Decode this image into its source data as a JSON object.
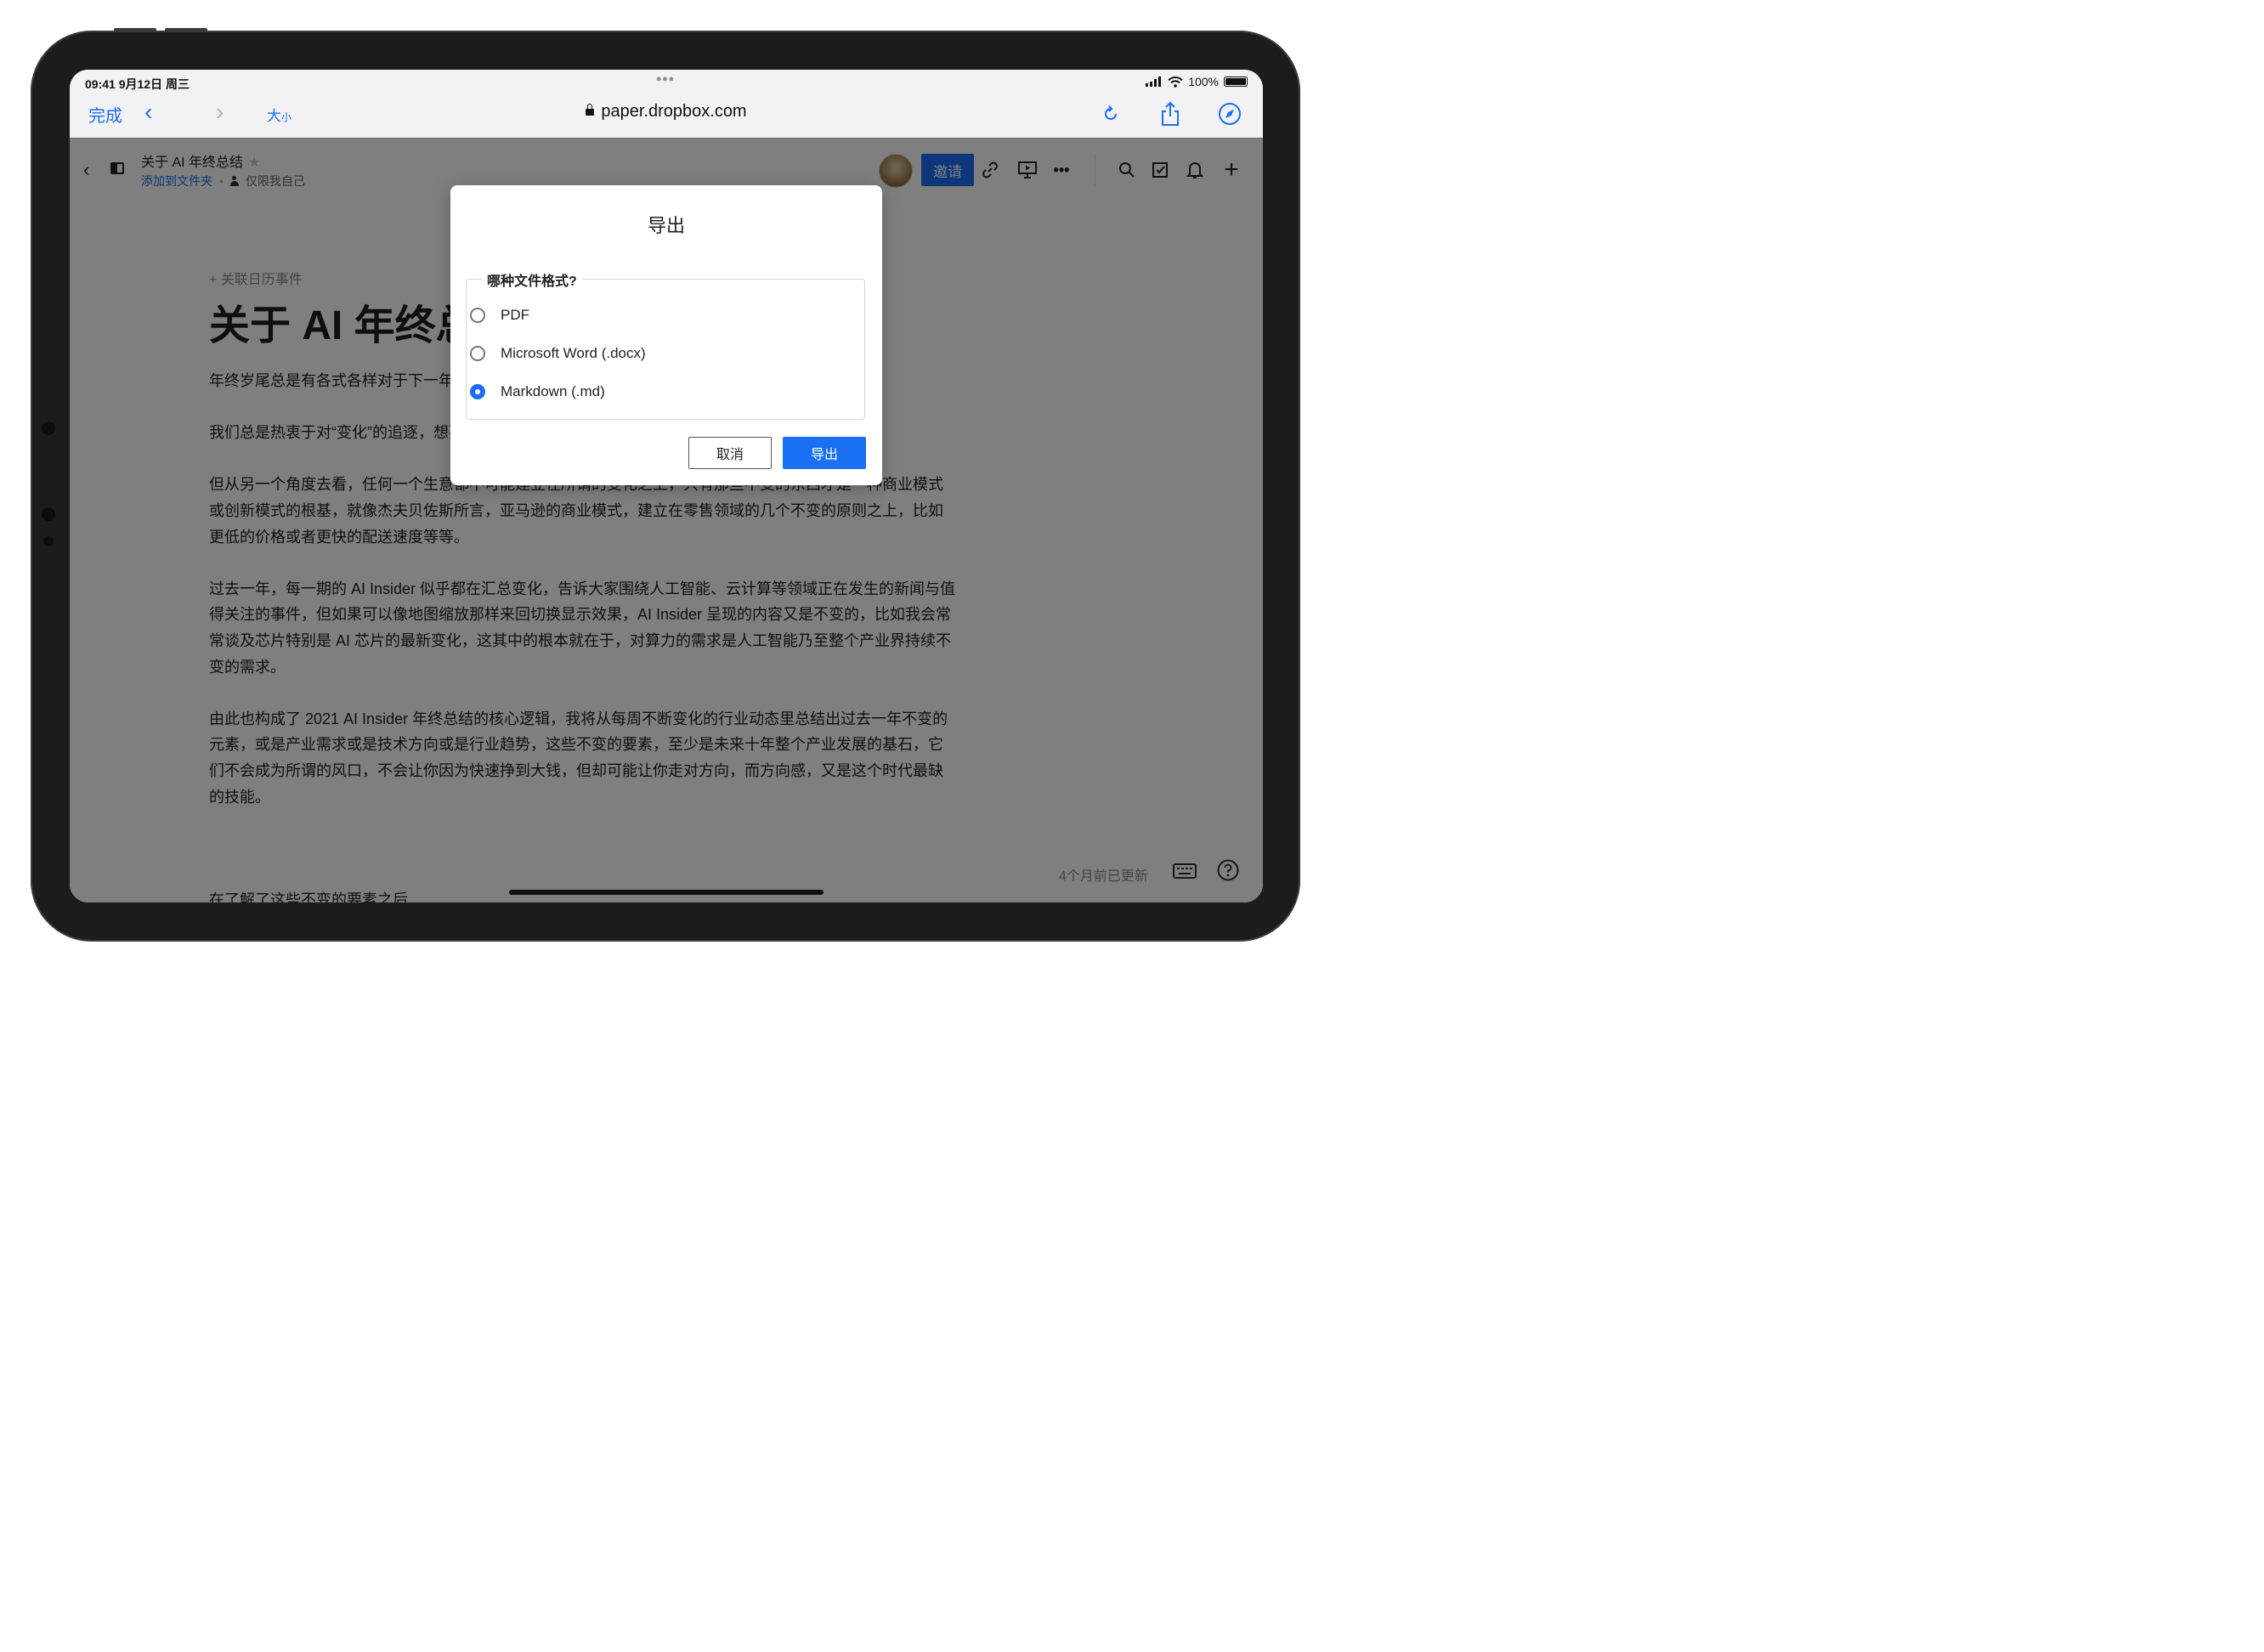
{
  "status_bar": {
    "time_date": "09:41   9月12日 周三",
    "dots": "•••",
    "battery": "100%"
  },
  "browser": {
    "done_label": "完成",
    "back_icon": "‹",
    "forward_icon": "›",
    "text_size_big": "大",
    "text_size_small": "小",
    "url": "paper.dropbox.com",
    "icons": [
      "reload-icon",
      "share-icon",
      "compass-icon"
    ]
  },
  "app_header": {
    "back_icon": "‹",
    "doc_title": "关于 AI 年终总结",
    "star": "★",
    "add_to_folder": "添加到文件夹",
    "separator": "•",
    "privacy": "仅限我自己",
    "invite_label": "邀请",
    "more_icon": "•••",
    "plus_icon": "+"
  },
  "document": {
    "calendar_link": "+ 关联日历事件",
    "heading": "关于 AI 年终总结",
    "paragraphs": [
      "年终岁尾总是有各式各样对于下一年的预测，各种畅想，各种展望，各种可能性。",
      "我们总是热衷于对“变化”的追逐，想要乘着风口起飞，成为站在风口上的那只猪。",
      "但从另一个角度去看，任何一个生意都不可能建立在所谓的变化之上，只有那些不变的东西才是一种商业模式或创新模式的根基，就像杰夫贝佐斯所言，亚马逊的商业模式，建立在零售领域的几个不变的原则之上，比如更低的价格或者更快的配送速度等等。",
      "过去一年，每一期的 AI Insider 似乎都在汇总变化，告诉大家围绕人工智能、云计算等领域正在发生的新闻与值得关注的事件，但如果可以像地图缩放那样来回切换显示效果，AI Insider 呈现的内容又是不变的，比如我会常常谈及芯片特别是 AI 芯片的最新变化，这其中的根本就在于，对算力的需求是人工智能乃至整个产业界持续不变的需求。",
      "由此也构成了 2021 AI Insider 年终总结的核心逻辑，我将从每周不断变化的行业动态里总结出过去一年不变的元素，或是产业需求或是技术方向或是行业趋势，这些不变的要素，至少是未来十年整个产业发展的基石，它们不会成为所谓的风口，不会让你因为快速挣到大钱，但却可能让你走对方向，而方向感，又是这个时代最缺的技能。"
    ],
    "cutoff_line": "在了解了这些不变的要素之后",
    "updated": "4个月前已更新"
  },
  "export_dialog": {
    "title": "导出",
    "legend": "哪种文件格式?",
    "options": [
      {
        "label": "PDF",
        "selected": false
      },
      {
        "label": "Microsoft Word (.docx)",
        "selected": false
      },
      {
        "label": "Markdown (.md)",
        "selected": true
      }
    ],
    "cancel_label": "取消",
    "export_label": "导出"
  },
  "colors": {
    "accent": "#1a6ff3",
    "overlay": "rgba(0,0,0,0.5)",
    "bezel": "#1c1c1e"
  }
}
